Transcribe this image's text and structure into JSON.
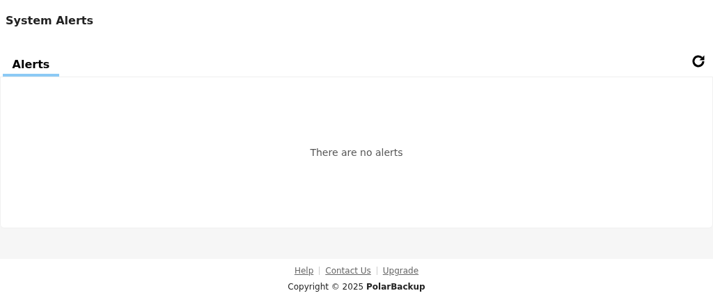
{
  "page_title": "System Alerts",
  "tabs": [
    {
      "label": "Alerts",
      "selected": true
    }
  ],
  "panel": {
    "empty_message": "There are no alerts"
  },
  "footer": {
    "links": [
      "Help",
      "Contact Us",
      "Upgrade"
    ],
    "copyright": "Copyright © 2025 **PolarBackup**"
  }
}
